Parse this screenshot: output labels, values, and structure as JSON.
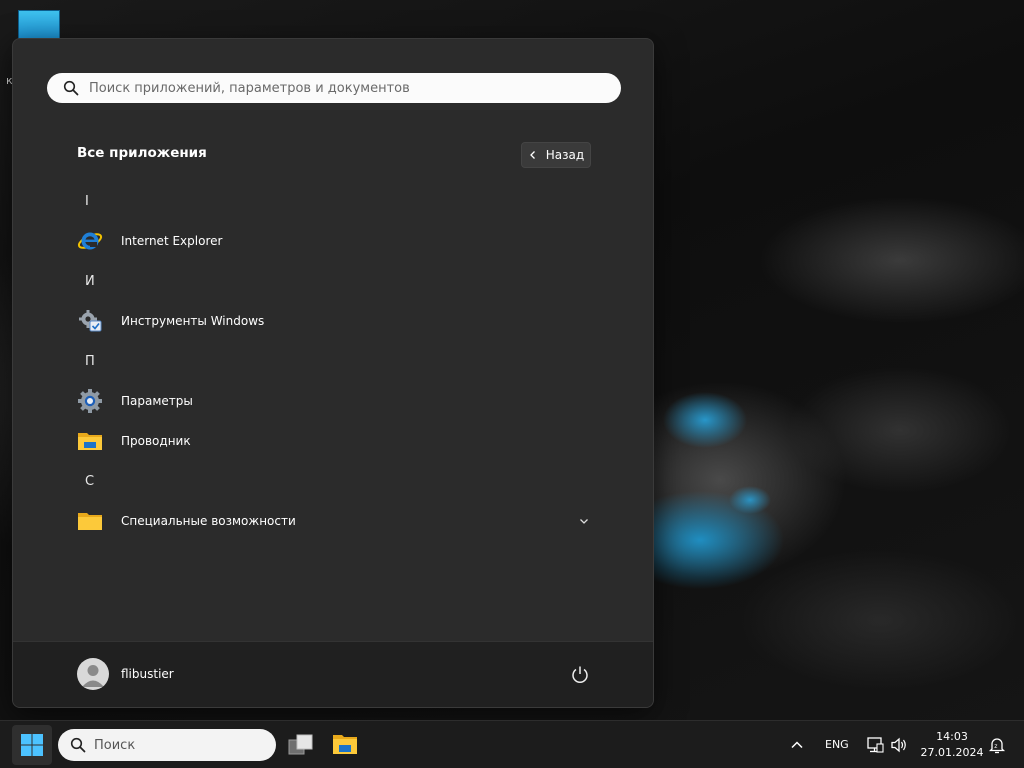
{
  "desktop": {
    "icon_label_fragment": "к"
  },
  "start_menu": {
    "search_placeholder": "Поиск приложений, параметров и документов",
    "header_title": "Все приложения",
    "back_label": "Назад",
    "groups": [
      {
        "letter": "I",
        "apps": [
          {
            "label": "Internet Explorer",
            "icon": "internet-explorer-icon"
          }
        ]
      },
      {
        "letter": "И",
        "apps": [
          {
            "label": "Инструменты Windows",
            "icon": "windows-tools-icon"
          }
        ]
      },
      {
        "letter": "П",
        "apps": [
          {
            "label": "Параметры",
            "icon": "settings-gear-icon"
          },
          {
            "label": "Проводник",
            "icon": "file-explorer-icon"
          }
        ]
      },
      {
        "letter": "С",
        "apps": [
          {
            "label": "Специальные возможности",
            "icon": "folder-icon",
            "expandable": true
          }
        ]
      }
    ],
    "user_name": "flibustier"
  },
  "taskbar": {
    "search_label": "Поиск",
    "language": "ENG",
    "time": "14:03",
    "date": "27.01.2024"
  },
  "colors": {
    "accent": "#0078d4",
    "menu_bg": "#2b2b2b",
    "taskbar_bg": "#1c1c1c"
  }
}
